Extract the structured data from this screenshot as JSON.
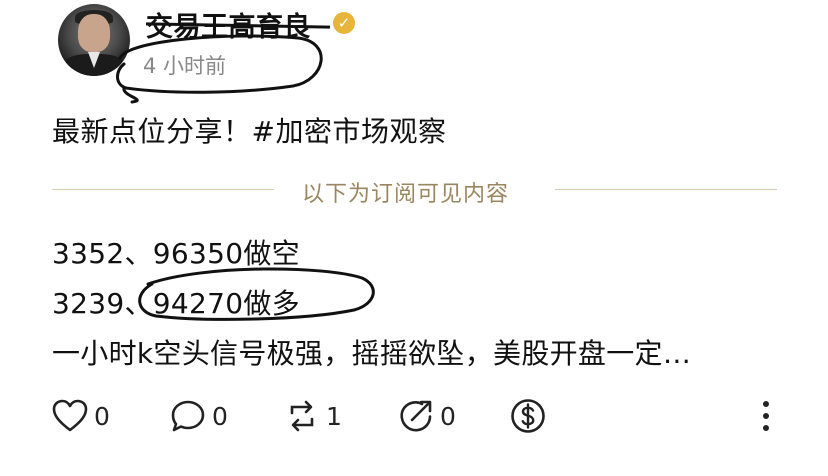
{
  "post": {
    "author": {
      "name": "交易王高育良",
      "verified_badge": "verified-icon"
    },
    "timestamp": "4 小时前",
    "text": "最新点位分享！#加密市场观察",
    "divider_label": "以下为订阅可见内容",
    "subscriber_lines": [
      "3352、96350做空",
      "3239、94270做多",
      "一小时k空头信号极强，摇摇欲坠，美股开盘一定…"
    ]
  },
  "actions": {
    "like": {
      "icon": "heart-icon",
      "count": "0"
    },
    "comment": {
      "icon": "comment-icon",
      "count": "0"
    },
    "repost": {
      "icon": "repost-icon",
      "count": "1"
    },
    "share": {
      "icon": "share-icon",
      "count": "0"
    },
    "tip": {
      "icon": "dollar-icon"
    },
    "more": {
      "icon": "more-vertical-icon"
    }
  },
  "colors": {
    "verified": "#e8b53c",
    "divider": "#d8cdb4",
    "divider_text": "#9a8760",
    "annotation": "#111111"
  }
}
